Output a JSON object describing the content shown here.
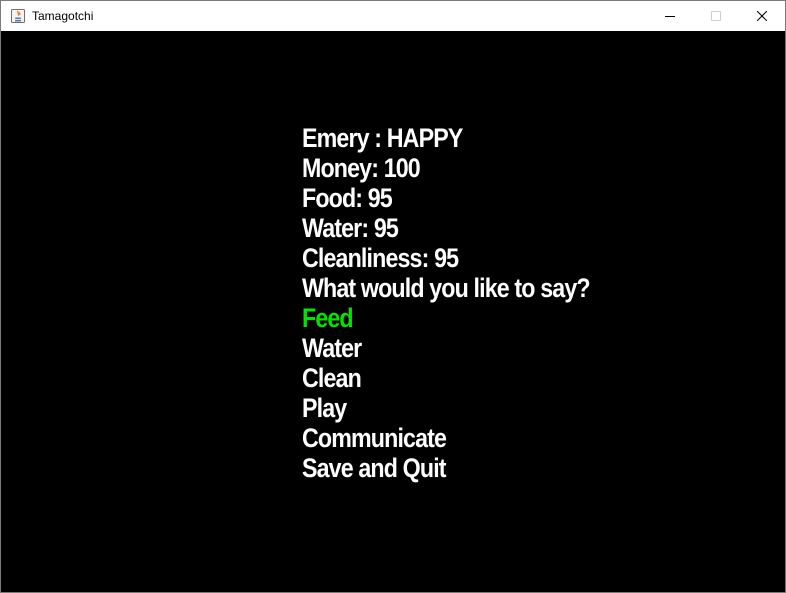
{
  "window": {
    "title": "Tamagotchi"
  },
  "status": {
    "pet_line": "Emery : HAPPY",
    "money_line": "Money: 100",
    "food_line": "Food: 95",
    "water_line": "Water: 95",
    "cleanliness_line": "Cleanliness: 95"
  },
  "prompt": "What would you like to say?",
  "menu": {
    "selected_index": 0,
    "selected_color": "#00e400",
    "items": [
      {
        "label": "Feed"
      },
      {
        "label": "Water"
      },
      {
        "label": "Clean"
      },
      {
        "label": "Play"
      },
      {
        "label": "Communicate"
      },
      {
        "label": "Save and Quit"
      }
    ]
  }
}
